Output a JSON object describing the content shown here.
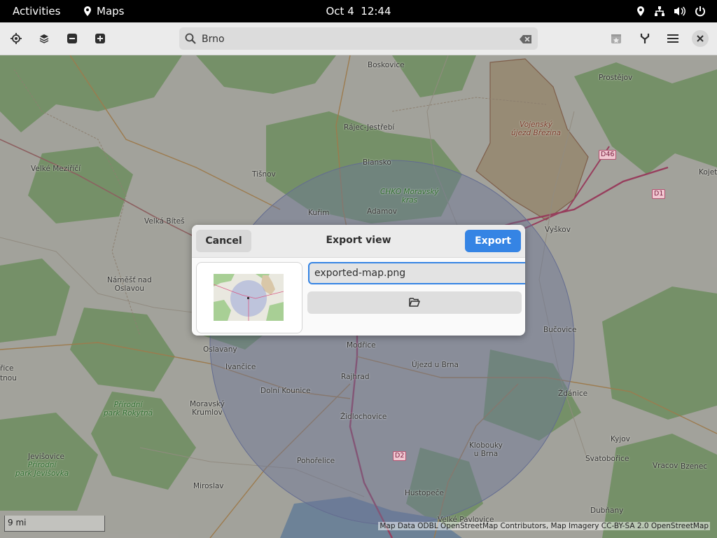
{
  "topbar": {
    "activities": "Activities",
    "app_name": "Maps",
    "date": "Oct 4",
    "time": "12:44",
    "icons": [
      "location-icon",
      "network-icon",
      "volume-icon",
      "power-icon"
    ]
  },
  "headerbar": {
    "search_value": "Brno",
    "left_icons": [
      "locate-icon",
      "layers-icon",
      "zoom-out-icon",
      "zoom-in-icon"
    ],
    "right_icons": [
      "favorites-icon",
      "route-icon",
      "menu-icon",
      "close-icon"
    ]
  },
  "map": {
    "places": {
      "boskovice": "Boskovice",
      "prostejov": "Prostějov",
      "rajec": "Rájec-Jestřebí",
      "vojensky": "Vojenský\nújezd Březina",
      "velke_mezirici": "Velké Meziříčí",
      "tisnov": "Tišnov",
      "blansko": "Blansko",
      "chko": "CHKO Moravský\nkras",
      "kojet": "Kojet",
      "kurim": "Kuřim",
      "adamov": "Adamov",
      "velka_bites": "Velká Bíteš",
      "vyskov": "Vyškov",
      "namest": "Náměšť nad\nOslavou",
      "bucovice": "Bučovice",
      "oslavany": "Oslavany",
      "ivancice": "Ivančice",
      "modrice": "Modřice",
      "ujezd": "Újezd u Brna",
      "rajhrad": "Rajhrad",
      "dolni_kounice": "Dolní Kounice",
      "zdanice": "Ždánice",
      "rice": "řice",
      "tnou": "tnou",
      "prirodni_rokytna": "Přírodní\npark Rokytná",
      "mor_krumlov": "Moravský\nKrumlov",
      "zidlochovice": "Židlochovice",
      "kyjov": "Kyjov",
      "klobouky": "Klobouky\nu Brna",
      "svatoborice": "Svatobořice",
      "jevisovice": "Jevišovice",
      "prirodni_jevisovka": "Přírodní\npark Jevišovka",
      "pohorelice": "Pohořelice",
      "vracov": "Vracov",
      "bzenec": "Bzenec",
      "miroslav": "Miroslav",
      "hustopece": "Hustopeče",
      "dubnany": "Dubňany",
      "velke_pavlovice": "Velké Pavlovice"
    },
    "shields": {
      "d46": "D46",
      "d1": "D1",
      "d2": "D2"
    },
    "scale": "9 mi",
    "attribution": "Map Data ODBL OpenStreetMap Contributors, Map Imagery CC-BY-SA 2.0 OpenStreetMap"
  },
  "dialog": {
    "title": "Export view",
    "cancel_label": "Cancel",
    "export_label": "Export",
    "filename": "exported-map.png",
    "folder_icon": "folder-open-icon"
  },
  "colors": {
    "accent": "#3584e4",
    "topbar": "#000000",
    "headerbar": "#ebebeb"
  }
}
